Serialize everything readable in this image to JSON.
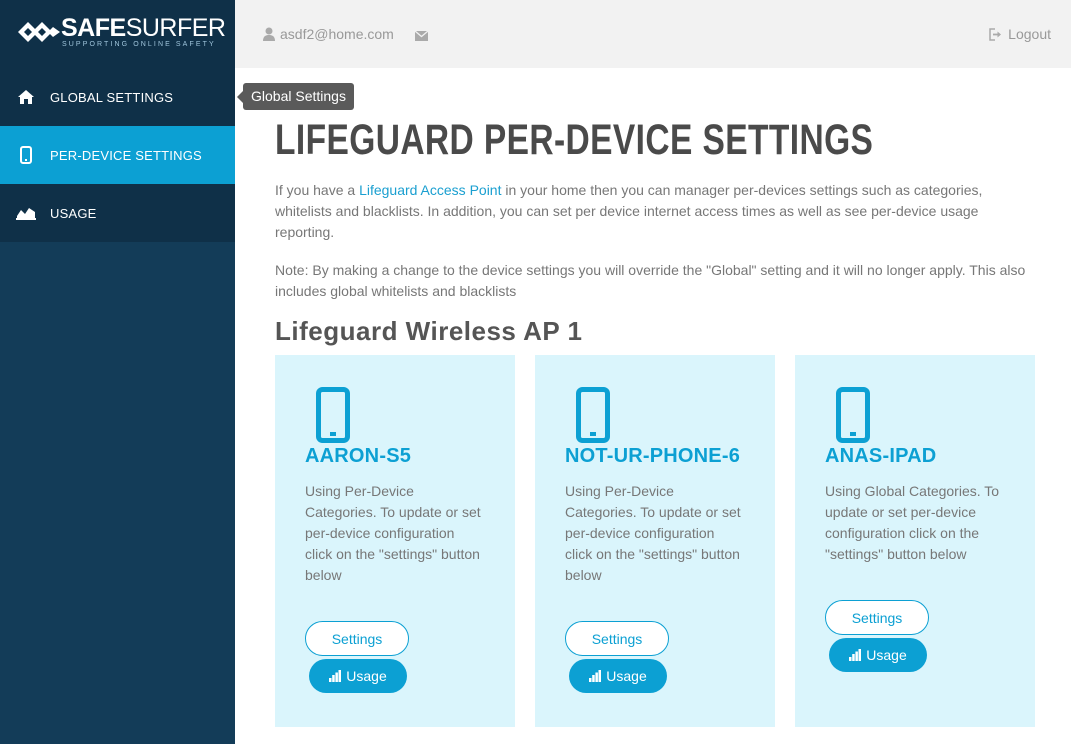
{
  "brand": {
    "name_bold": "SAFE",
    "name_thin": "SURFER",
    "tagline": "SUPPORTING ONLINE SAFETY"
  },
  "sidebar": {
    "items": [
      {
        "label": "GLOBAL SETTINGS",
        "icon": "home-icon",
        "active": false
      },
      {
        "label": "PER-DEVICE SETTINGS",
        "icon": "mobile-icon",
        "active": true
      },
      {
        "label": "USAGE",
        "icon": "area-chart-icon",
        "active": false
      }
    ]
  },
  "tooltip": {
    "text": "Global Settings"
  },
  "header": {
    "user_email": "asdf2@home.com",
    "logout_label": "Logout"
  },
  "main": {
    "title": "LIFEGUARD PER-DEVICE SETTINGS",
    "intro_before": "If you have a ",
    "intro_link": "Lifeguard Access Point",
    "intro_after": " in your home then you can manager per-devices settings such as categories, whitelists and blacklists. In addition, you can set per device internet access times as well as see per-device usage reporting.",
    "note": "Note: By making a change to the device settings you will override the \"Global\" setting and it will no longer apply. This also includes global whitelists and blacklists",
    "ap_title": "Lifeguard Wireless AP 1",
    "devices": [
      {
        "name": "AARON-S5",
        "description": "Using Per-Device Categories. To update or set per-device configuration click on the \"settings\" button below",
        "settings_label": "Settings",
        "usage_label": "Usage"
      },
      {
        "name": "NOT-UR-PHONE-6",
        "description": "Using Per-Device Categories. To update or set per-device configuration click on the \"settings\" button below",
        "settings_label": "Settings",
        "usage_label": "Usage"
      },
      {
        "name": "ANAS-IPAD",
        "description": "Using Global Categories. To update or set per-device configuration click on the \"settings\" button below",
        "settings_label": "Settings",
        "usage_label": "Usage"
      }
    ]
  },
  "colors": {
    "accent": "#0ca0d3",
    "sidebar": "#133c58",
    "card": "#daf5fc"
  }
}
